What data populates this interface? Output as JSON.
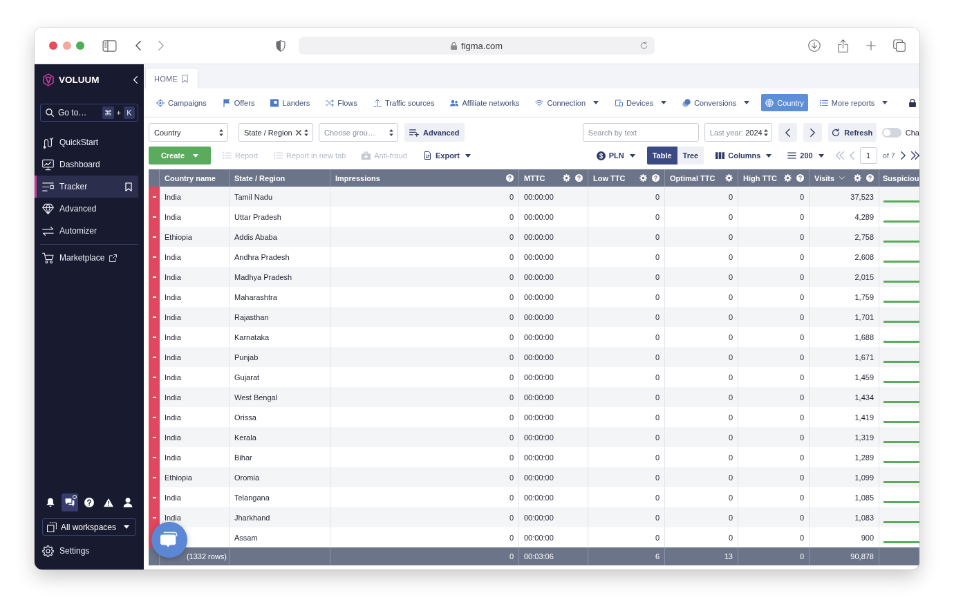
{
  "browser": {
    "url": "figma.com"
  },
  "sidebar": {
    "brand": "VOLUUM",
    "search": {
      "placeholder": "Go to…",
      "shortcut_keys": [
        "⌘",
        "K"
      ],
      "shortcut_joiner": "+"
    },
    "sections": [
      {
        "items": [
          {
            "label": "QuickStart",
            "selected": false,
            "external": false
          },
          {
            "label": "Dashboard",
            "selected": false,
            "external": false
          },
          {
            "label": "Tracker",
            "selected": true,
            "external": false
          },
          {
            "label": "Advanced",
            "selected": false,
            "external": false
          },
          {
            "label": "Automizer",
            "selected": false,
            "external": false
          }
        ]
      },
      {
        "items": [
          {
            "label": "Marketplace",
            "selected": false,
            "external": true
          }
        ]
      }
    ],
    "toolbar": [
      {
        "selected": false,
        "badge": false
      },
      {
        "selected": true,
        "badge": true
      },
      {
        "selected": false,
        "badge": false
      },
      {
        "selected": false,
        "badge": false
      },
      {
        "selected": false,
        "badge": false
      }
    ],
    "workspace": "All workspaces",
    "settings": "Settings"
  },
  "main": {
    "tabs": [
      {
        "label": "HOME",
        "selected": true
      }
    ],
    "nav": [
      {
        "label": "Campaigns",
        "dropdown": false,
        "selected": false
      },
      {
        "label": "Offers",
        "dropdown": false,
        "selected": false
      },
      {
        "label": "Landers",
        "dropdown": false,
        "selected": false
      },
      {
        "label": "Flows",
        "dropdown": false,
        "selected": false
      },
      {
        "label": "Traffic sources",
        "dropdown": false,
        "selected": false
      },
      {
        "label": "Affiliate networks",
        "dropdown": false,
        "selected": false
      },
      {
        "label": "Connection",
        "dropdown": true,
        "selected": false
      },
      {
        "label": "Devices",
        "dropdown": true,
        "selected": false
      },
      {
        "label": "Conversions",
        "dropdown": true,
        "selected": false
      },
      {
        "label": "Country",
        "dropdown": false,
        "selected": true
      },
      {
        "label": "More reports",
        "dropdown": true,
        "selected": false
      }
    ],
    "filters": {
      "groups": [
        {
          "value": "Country",
          "clearable": false
        },
        {
          "value": "State / Region",
          "clearable": true
        },
        {
          "placeholder": "Choose grou…",
          "clearable": false
        }
      ],
      "advanced": "Advanced",
      "search_placeholder": "Search by text",
      "date": {
        "label": "Last year:",
        "value": "2024"
      },
      "refresh": "Refresh",
      "toggle": {
        "on": false,
        "label": "Cha"
      }
    },
    "actions": [
      {
        "label": "Create",
        "kind": "primary",
        "dropdown": true,
        "disabled": false
      },
      {
        "label": "Report",
        "kind": "plain",
        "dropdown": false,
        "disabled": true
      },
      {
        "label": "Report in new tab",
        "kind": "plain",
        "dropdown": false,
        "disabled": true
      },
      {
        "label": "Anti-fraud",
        "kind": "plain",
        "dropdown": false,
        "disabled": true
      },
      {
        "label": "Export",
        "kind": "plain",
        "dropdown": true,
        "disabled": false
      }
    ],
    "view": {
      "currency": "PLN",
      "modes": [
        {
          "label": "Table",
          "selected": true
        },
        {
          "label": "Tree",
          "selected": false
        }
      ],
      "columns": "Columns",
      "page_size": "200",
      "pagination": {
        "page": "1",
        "of": "of 7"
      }
    },
    "table": {
      "columns": [
        {
          "label": "Country name",
          "sorted": false,
          "settings": false,
          "help": false
        },
        {
          "label": "State / Region",
          "sorted": false,
          "settings": false,
          "help": false
        },
        {
          "label": "Impressions",
          "sorted": false,
          "settings": false,
          "help": true
        },
        {
          "label": "MTTC",
          "sorted": false,
          "settings": true,
          "help": true
        },
        {
          "label": "Low TTC",
          "sorted": false,
          "settings": true,
          "help": true
        },
        {
          "label": "Optimal TTC",
          "sorted": false,
          "settings": true,
          "help": false
        },
        {
          "label": "High TTC",
          "sorted": false,
          "settings": true,
          "help": true
        },
        {
          "label": "Visits",
          "sorted": true,
          "settings": true,
          "help": true
        },
        {
          "label": "Suspiciou"
        }
      ],
      "rows": [
        {
          "country_name": "India",
          "state_region": "Tamil Nadu",
          "impressions": "0",
          "mttc": "00:00:00",
          "low_ttc": "0",
          "optimal_ttc": "0",
          "high_ttc": "0",
          "visits": "37,523"
        },
        {
          "country_name": "India",
          "state_region": "Uttar Pradesh",
          "impressions": "0",
          "mttc": "00:00:00",
          "low_ttc": "0",
          "optimal_ttc": "0",
          "high_ttc": "0",
          "visits": "4,289"
        },
        {
          "country_name": "Ethiopia",
          "state_region": "Addis Ababa",
          "impressions": "0",
          "mttc": "00:00:00",
          "low_ttc": "0",
          "optimal_ttc": "0",
          "high_ttc": "0",
          "visits": "2,758"
        },
        {
          "country_name": "India",
          "state_region": "Andhra Pradesh",
          "impressions": "0",
          "mttc": "00:00:00",
          "low_ttc": "0",
          "optimal_ttc": "0",
          "high_ttc": "0",
          "visits": "2,608"
        },
        {
          "country_name": "India",
          "state_region": "Madhya Pradesh",
          "impressions": "0",
          "mttc": "00:00:00",
          "low_ttc": "0",
          "optimal_ttc": "0",
          "high_ttc": "0",
          "visits": "2,015"
        },
        {
          "country_name": "India",
          "state_region": "Maharashtra",
          "impressions": "0",
          "mttc": "00:00:00",
          "low_ttc": "0",
          "optimal_ttc": "0",
          "high_ttc": "0",
          "visits": "1,759"
        },
        {
          "country_name": "India",
          "state_region": "Rajasthan",
          "impressions": "0",
          "mttc": "00:00:00",
          "low_ttc": "0",
          "optimal_ttc": "0",
          "high_ttc": "0",
          "visits": "1,701"
        },
        {
          "country_name": "India",
          "state_region": "Karnataka",
          "impressions": "0",
          "mttc": "00:00:00",
          "low_ttc": "0",
          "optimal_ttc": "0",
          "high_ttc": "0",
          "visits": "1,688"
        },
        {
          "country_name": "India",
          "state_region": "Punjab",
          "impressions": "0",
          "mttc": "00:00:00",
          "low_ttc": "0",
          "optimal_ttc": "0",
          "high_ttc": "0",
          "visits": "1,671"
        },
        {
          "country_name": "India",
          "state_region": "Gujarat",
          "impressions": "0",
          "mttc": "00:00:00",
          "low_ttc": "0",
          "optimal_ttc": "0",
          "high_ttc": "0",
          "visits": "1,459"
        },
        {
          "country_name": "India",
          "state_region": "West Bengal",
          "impressions": "0",
          "mttc": "00:00:00",
          "low_ttc": "0",
          "optimal_ttc": "0",
          "high_ttc": "0",
          "visits": "1,434"
        },
        {
          "country_name": "India",
          "state_region": "Orissa",
          "impressions": "0",
          "mttc": "00:00:00",
          "low_ttc": "0",
          "optimal_ttc": "0",
          "high_ttc": "0",
          "visits": "1,419"
        },
        {
          "country_name": "India",
          "state_region": "Kerala",
          "impressions": "0",
          "mttc": "00:00:00",
          "low_ttc": "0",
          "optimal_ttc": "0",
          "high_ttc": "0",
          "visits": "1,319"
        },
        {
          "country_name": "India",
          "state_region": "Bihar",
          "impressions": "0",
          "mttc": "00:00:00",
          "low_ttc": "0",
          "optimal_ttc": "0",
          "high_ttc": "0",
          "visits": "1,289"
        },
        {
          "country_name": "Ethiopia",
          "state_region": "Oromia",
          "impressions": "0",
          "mttc": "00:00:00",
          "low_ttc": "0",
          "optimal_ttc": "0",
          "high_ttc": "0",
          "visits": "1,099"
        },
        {
          "country_name": "India",
          "state_region": "Telangana",
          "impressions": "0",
          "mttc": "00:00:00",
          "low_ttc": "0",
          "optimal_ttc": "0",
          "high_ttc": "0",
          "visits": "1,085"
        },
        {
          "country_name": "India",
          "state_region": "Jharkhand",
          "impressions": "0",
          "mttc": "00:00:00",
          "low_ttc": "0",
          "optimal_ttc": "0",
          "high_ttc": "0",
          "visits": "1,083"
        },
        {
          "state_region": "Assam",
          "impressions": "0",
          "mttc": "00:00:00",
          "low_ttc": "0",
          "optimal_ttc": "0",
          "high_ttc": "0",
          "visits": "900"
        }
      ],
      "footer": {
        "rows_count": "(1332 rows)",
        "impressions": "0",
        "mttc": "00:03:06",
        "low_ttc": "6",
        "optimal_ttc": "13",
        "high_ttc": "0",
        "visits": "90,878"
      }
    }
  }
}
